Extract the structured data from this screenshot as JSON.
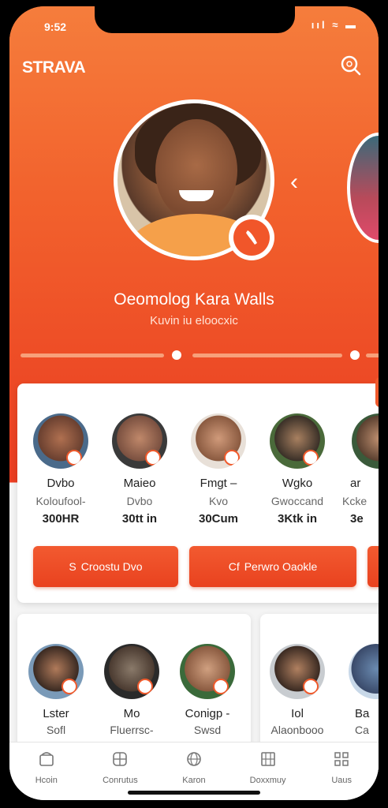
{
  "status": {
    "time": "9:52",
    "icons": "ııl ≈ ▬"
  },
  "header": {
    "brand": "STRAVA",
    "search_icon": "search-icon"
  },
  "hero": {
    "name": "Oeomolog Kara Walls",
    "subtitle": "Kuvin iu eloocxic",
    "badge_icon": "shoe-icon"
  },
  "athletes": [
    {
      "name": "Dvbo",
      "label": "Koloufool-",
      "stat": "300HR"
    },
    {
      "name": "Maieo",
      "label": "Dvbo",
      "stat": "30tt in"
    },
    {
      "name": "Fmgt –",
      "label": "Kvo",
      "stat": "30Cum"
    },
    {
      "name": "Wgko",
      "label": "Gwoccand",
      "stat": "3Ktk in"
    },
    {
      "name": "ar",
      "label": "Kcke",
      "stat": "3e"
    }
  ],
  "actions": [
    {
      "label": "Croostu Dvo",
      "icon": "S"
    },
    {
      "label": "Perwro Oaokle",
      "icon": "Cf"
    }
  ],
  "cards2": [
    [
      {
        "name": "Lster",
        "label": "Sofl"
      },
      {
        "name": "Mo",
        "label": "Fluerrsc-"
      },
      {
        "name": "Conigp -",
        "label": "Swsd"
      }
    ],
    [
      {
        "name": "Iol",
        "label": "Alaonbooo"
      },
      {
        "name": "Ba",
        "label": "Ca"
      }
    ]
  ],
  "tabs": [
    {
      "label": "Hcoin",
      "icon": "home-icon"
    },
    {
      "label": "Conrutus",
      "icon": "groups-icon"
    },
    {
      "label": "Karon",
      "icon": "globe-icon"
    },
    {
      "label": "Doxxmuy",
      "icon": "calendar-icon"
    },
    {
      "label": "Uaus",
      "icon": "grid-icon"
    }
  ],
  "colors": {
    "accent": "#f05a2c",
    "accent_dark": "#e9421f",
    "card_bg": "#ffffff"
  }
}
